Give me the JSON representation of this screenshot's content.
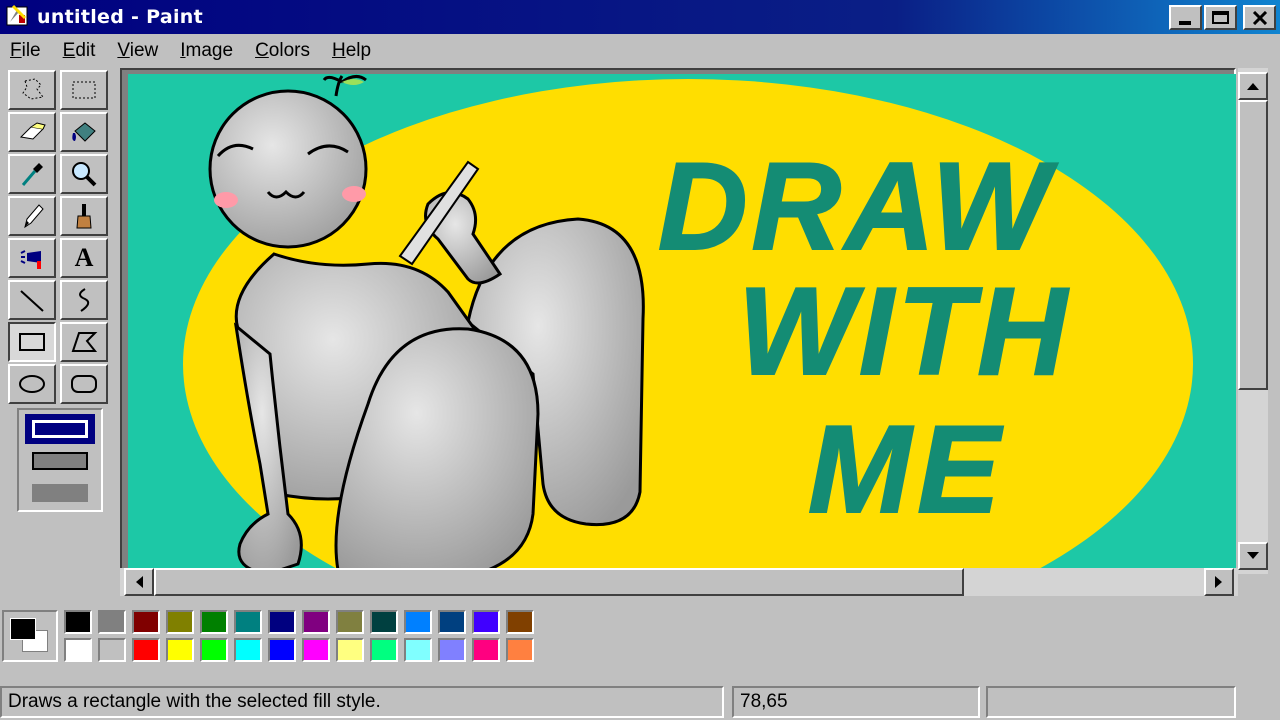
{
  "window": {
    "title": "untitled - Paint",
    "app_icon": "paint-app-icon"
  },
  "window_controls": [
    {
      "name": "minimize-button",
      "icon": "minimize-icon"
    },
    {
      "name": "maximize-button",
      "icon": "maximize-icon"
    },
    {
      "name": "close-button",
      "icon": "close-icon"
    }
  ],
  "menu": [
    {
      "label": "File",
      "accel": "F",
      "rest": "ile"
    },
    {
      "label": "Edit",
      "accel": "E",
      "rest": "dit"
    },
    {
      "label": "View",
      "accel": "V",
      "rest": "iew"
    },
    {
      "label": "Image",
      "accel": "I",
      "rest": "mage"
    },
    {
      "label": "Colors",
      "accel": "C",
      "rest": "olors"
    },
    {
      "label": "Help",
      "accel": "H",
      "rest": "elp"
    }
  ],
  "tools": [
    {
      "name": "free-form-select",
      "icon": "free-form-select-icon"
    },
    {
      "name": "rect-select",
      "icon": "rect-select-icon"
    },
    {
      "name": "eraser",
      "icon": "eraser-icon"
    },
    {
      "name": "fill",
      "icon": "paint-bucket-icon"
    },
    {
      "name": "pick-color",
      "icon": "eyedropper-icon"
    },
    {
      "name": "magnifier",
      "icon": "magnifier-icon"
    },
    {
      "name": "pencil",
      "icon": "pencil-icon"
    },
    {
      "name": "brush",
      "icon": "brush-icon"
    },
    {
      "name": "airbrush",
      "icon": "airbrush-icon"
    },
    {
      "name": "text",
      "icon": "text-icon",
      "glyph": "A"
    },
    {
      "name": "line",
      "icon": "line-icon"
    },
    {
      "name": "curve",
      "icon": "curve-icon"
    },
    {
      "name": "rectangle",
      "icon": "rectangle-icon",
      "selected": true
    },
    {
      "name": "polygon",
      "icon": "polygon-icon"
    },
    {
      "name": "ellipse",
      "icon": "ellipse-icon"
    },
    {
      "name": "rounded-rectangle",
      "icon": "rounded-rectangle-icon"
    }
  ],
  "fill_styles": [
    "outline",
    "outline-fill",
    "fill"
  ],
  "fill_style_selected": "outline",
  "canvas": {
    "background": "#1dc8a6",
    "ellipse_color": "#ffde00",
    "text_color": "#148c74",
    "text_lines": [
      "DRAW",
      "WITH",
      "ME"
    ]
  },
  "palette": {
    "foreground": "#000000",
    "background": "#ffffff",
    "row1": [
      "#000000",
      "#808080",
      "#800000",
      "#808000",
      "#008000",
      "#008080",
      "#000080",
      "#800080",
      "#808040",
      "#004040",
      "#0080ff",
      "#004080",
      "#4000ff",
      "#804000"
    ],
    "row2": [
      "#ffffff",
      "#c0c0c0",
      "#ff0000",
      "#ffff00",
      "#00ff00",
      "#00ffff",
      "#0000ff",
      "#ff00ff",
      "#ffff80",
      "#00ff80",
      "#80ffff",
      "#8080ff",
      "#ff0080",
      "#ff8040"
    ]
  },
  "status": {
    "message": "Draws a rectangle with the selected fill style.",
    "coords": "78,65",
    "size": ""
  }
}
